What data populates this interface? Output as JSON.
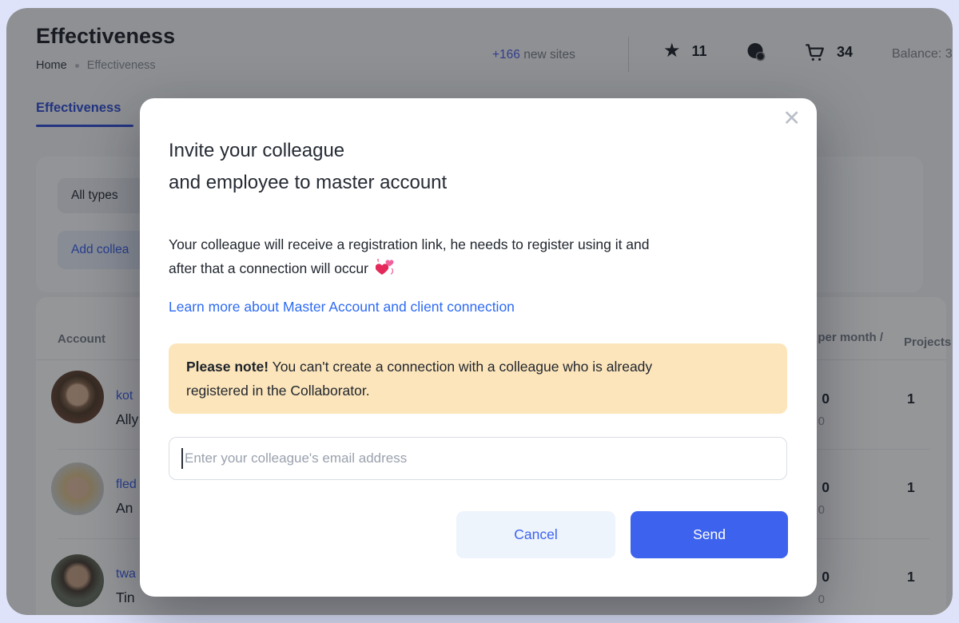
{
  "page": {
    "title": "Effectiveness",
    "breadcrumb": {
      "home": "Home",
      "current": "Effectiveness"
    },
    "topbar": {
      "new_sites_count": "+166",
      "new_sites_label": "new sites",
      "favorites_count": "11",
      "cart_count": "34",
      "balance_label": "Balance:",
      "balance_value": "3"
    },
    "tab_label": "Effectiveness",
    "filters": {
      "type_select_value": "All types",
      "add_colleague_label": "Add collea"
    },
    "table": {
      "headers": {
        "account": "Account",
        "per_month": "per month /",
        "projects": "Projects"
      },
      "rows": [
        {
          "link": "kot",
          "name": "Ally",
          "value": "0",
          "value_sub": "0",
          "projects": "1"
        },
        {
          "link": "fled",
          "name": "An",
          "value": "0",
          "value_sub": "0",
          "projects": "1"
        },
        {
          "link": "twa",
          "name": "Tin",
          "value": "0",
          "value_sub": "0",
          "projects": "1"
        }
      ]
    }
  },
  "modal": {
    "title_line1": "Invite your colleague",
    "title_line2": "and employee to master account",
    "body_line1": "Your colleague will receive a registration link, he needs to register using it and",
    "body_line2": "after that a connection will occur",
    "emoji_icon": "revolving-hearts",
    "link_label": "Learn more about Master Account and client connection",
    "note_bold": "Please note!",
    "note_line1": "You can't create a connection with a colleague who is already",
    "note_line2": "registered in the Collaborator.",
    "input_placeholder": "Enter your colleague's email address",
    "cancel_label": "Cancel",
    "send_label": "Send",
    "close_glyph": "✕"
  },
  "colors": {
    "accent_blue": "#3d62ee",
    "link_blue": "#2e6bf2",
    "tab_blue": "#3450d6",
    "note_bg": "#fce5bb",
    "outer_lavender": "#dee3f9",
    "cancel_bg": "#edf4fc"
  }
}
